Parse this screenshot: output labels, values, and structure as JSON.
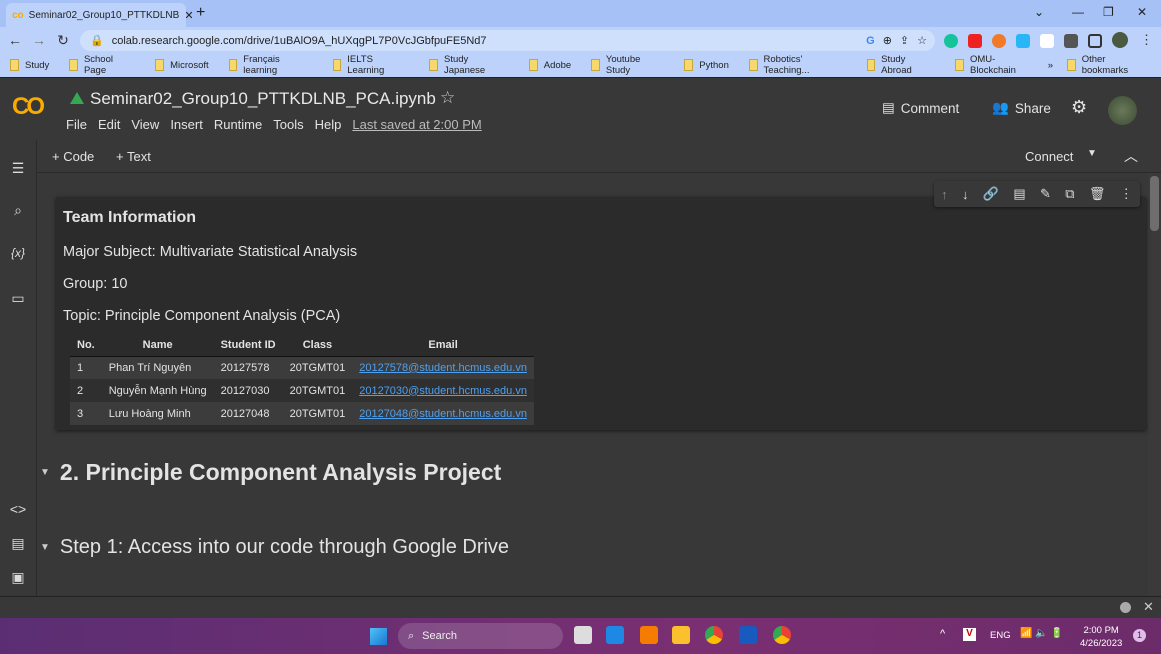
{
  "browser": {
    "tab_title": "Seminar02_Group10_PTTKDLNB",
    "url": "colab.research.google.com/drive/1uBAlO9A_hUXqgPL7P0VcJGbfpuFE5Nd7",
    "bookmarks": [
      "Study",
      "School Page",
      "Microsoft",
      "Français learning",
      "IELTS Learning",
      "Study Japanese",
      "Adobe",
      "Youtube Study",
      "Python",
      "Robotics' Teaching...",
      "Study Abroad",
      "OMU-Blockchain"
    ],
    "more_bookmarks": "»",
    "other_bookmarks": "Other bookmarks"
  },
  "colab": {
    "logo": "CO",
    "notebook_title": "Seminar02_Group10_PTTKDLNB_PCA.ipynb",
    "menu": [
      "File",
      "Edit",
      "View",
      "Insert",
      "Runtime",
      "Tools",
      "Help"
    ],
    "last_saved": "Last saved at 2:00 PM",
    "comment": "Comment",
    "share": "Share",
    "add_code": "+ Code",
    "add_text": "+ Text",
    "connect": "Connect"
  },
  "cell": {
    "heading": "Team Information",
    "subject": "Major Subject: Multivariate Statistical Analysis",
    "group": "Group: 10",
    "topic": "Topic: Principle Component Analysis (PCA)",
    "table": {
      "headers": [
        "No.",
        "Name",
        "Student ID",
        "Class",
        "Email"
      ],
      "rows": [
        [
          "1",
          "Phan Trí Nguyên",
          "20127578",
          "20TGMT01",
          "20127578@student.hcmus.edu.vn"
        ],
        [
          "2",
          "Nguyễn Mạnh Hùng",
          "20127030",
          "20TGMT01",
          "20127030@student.hcmus.edu.vn"
        ],
        [
          "3",
          "Lưu Hoàng Minh",
          "20127048",
          "20TGMT01",
          "20127048@student.hcmus.edu.vn"
        ]
      ]
    }
  },
  "sections": {
    "s2": "2. Principle Component Analysis Project",
    "step1": "Step 1: Access into our code through Google Drive"
  },
  "taskbar": {
    "search": "Search",
    "lang": "ENG",
    "time": "2:00 PM",
    "date": "4/26/2023",
    "notifications": "1"
  }
}
